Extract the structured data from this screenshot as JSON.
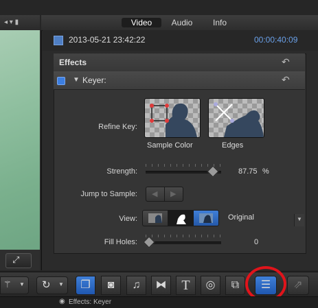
{
  "tabs": [
    "Video",
    "Audio",
    "Info"
  ],
  "clip": {
    "date": "2013-05-21 23:42:22",
    "timecode": "00:00:40:09"
  },
  "effects_panel": {
    "title": "Effects",
    "keyer_title": "Keyer:"
  },
  "refine_key": {
    "label": "Refine Key:",
    "sample_color": "Sample Color",
    "edges": "Edges"
  },
  "strength": {
    "label": "Strength:",
    "value": "87.75",
    "unit": "%",
    "fraction": 0.8775
  },
  "jump": {
    "label": "Jump to Sample:"
  },
  "view": {
    "label": "View:",
    "value": "Original"
  },
  "fill_holes": {
    "label": "Fill Holes:",
    "value": "0"
  },
  "bottom_tab": "Effects: Keyer",
  "colors": {
    "accent": "#3c7ee0",
    "timecode": "#6aa0e8",
    "highlight_circle": "#e0141b"
  }
}
